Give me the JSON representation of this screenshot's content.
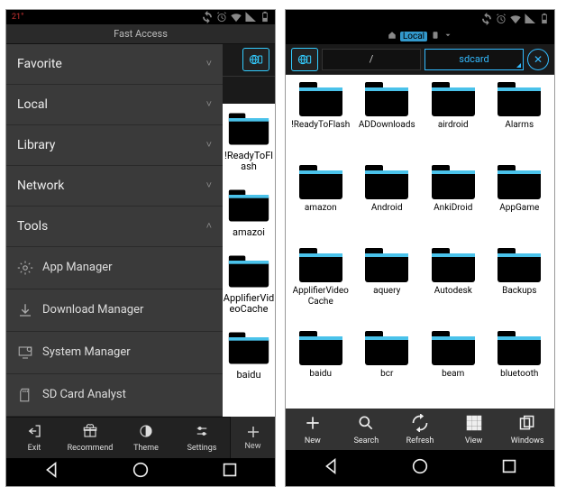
{
  "left": {
    "temp": "21°",
    "header": "Fast Access",
    "categories": [
      {
        "label": "Favorite",
        "expanded": false
      },
      {
        "label": "Local",
        "expanded": false
      },
      {
        "label": "Library",
        "expanded": false
      },
      {
        "label": "Network",
        "expanded": false
      },
      {
        "label": "Tools",
        "expanded": true
      }
    ],
    "tools": [
      {
        "icon": "gear",
        "label": "App Manager"
      },
      {
        "icon": "download",
        "label": "Download Manager"
      },
      {
        "icon": "monitor",
        "label": "System Manager"
      },
      {
        "icon": "sd",
        "label": "SD Card Analyst"
      }
    ],
    "bottom": [
      {
        "icon": "exit",
        "label": "Exit"
      },
      {
        "icon": "gift",
        "label": "Recommend"
      },
      {
        "icon": "theme",
        "label": "Theme"
      },
      {
        "icon": "sliders",
        "label": "Settings"
      }
    ],
    "new_label": "New",
    "partial_folders": [
      "!ReadyToFlash",
      "amazoi",
      "ApplifierVideoCache",
      "baidu"
    ]
  },
  "right": {
    "loc_label": "Local",
    "path": {
      "root": "/",
      "current": "sdcard"
    },
    "folders": [
      "!ReadyToFlash",
      "ADDownloads",
      "airdroid",
      "Alarms",
      "amazon",
      "Android",
      "AnkiDroid",
      "AppGame",
      "ApplifierVideoCache",
      "aquery",
      "Autodesk",
      "Backups",
      "baidu",
      "bcr",
      "beam",
      "bluetooth"
    ],
    "bottom": [
      {
        "icon": "plus",
        "label": "New"
      },
      {
        "icon": "search",
        "label": "Search"
      },
      {
        "icon": "refresh",
        "label": "Refresh"
      },
      {
        "icon": "grid",
        "label": "View"
      },
      {
        "icon": "windows",
        "label": "Windows"
      }
    ]
  }
}
